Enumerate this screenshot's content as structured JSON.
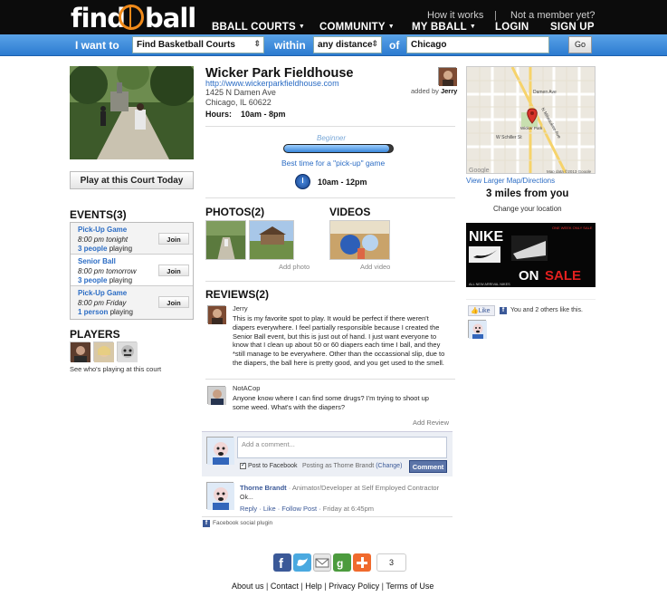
{
  "header": {
    "logo": "findbball",
    "nav": [
      "BBALL COURTS",
      "COMMUNITY",
      "MY BBALL"
    ],
    "how_it_works": "How it works",
    "not_member": "Not a member yet?",
    "login": "LOGIN",
    "signup": "SIGN UP"
  },
  "search": {
    "label_want": "I want to",
    "what": "Find Basketball Courts",
    "label_within": "within",
    "distance": "any distance",
    "label_of": "of",
    "location": "Chicago",
    "go": "Go"
  },
  "court": {
    "name": "Wicker Park Fieldhouse",
    "url": "http://www.wickerparkfieldhouse.com",
    "address1": "1425 N Damen Ave",
    "address2": "Chicago, IL 60622",
    "hours_label": "Hours:",
    "hours": "10am - 8pm",
    "added_by_label": "added by",
    "added_by": "Jerry",
    "play_button": "Play at this Court Today",
    "level": "Beginner",
    "level_fraction": 0.97,
    "best_time_label": "Best time for a \"pick-up\" game",
    "best_time": "10am - 12pm"
  },
  "events": {
    "title": "EVENTS(3)",
    "join_label": "Join",
    "items": [
      {
        "title": "Pick-Up Game",
        "when": "8:00 pm tonight",
        "count": "3 people",
        "suffix": "playing"
      },
      {
        "title": "Senior Ball",
        "when": "8:00 pm tomorrow",
        "count": "3 people",
        "suffix": "playing"
      },
      {
        "title": "Pick-Up Game",
        "when": "8:00 pm Friday",
        "count": "1 person",
        "suffix": "playing"
      }
    ]
  },
  "players": {
    "title": "PLAYERS",
    "see_link": "See who's playing at this court"
  },
  "media": {
    "photos_title": "PHOTOS(2)",
    "videos_title": "VIDEOS",
    "add_photo": "Add photo",
    "add_video": "Add video"
  },
  "reviews": {
    "title": "REVIEWS(2)",
    "add_review": "Add Review",
    "items": [
      {
        "name": "Jerry",
        "text": "This is my favorite spot to play. It would be perfect if there weren't diapers everywhere. I feel partially responsible because I created the Senior Ball event, but this is just out of hand.  I just want everyone to know that I clean up about 50 or 60 diapers each time I ball, and they *still manage to be everywhere.   Other than the occassional slip, due to the diapers, the ball here is pretty good, and you get used to the smell."
      },
      {
        "name": "NotACop",
        "text": "Anyone know where I can find some drugs?  I'm trying to shoot up some weed.  What's with the diapers?"
      }
    ]
  },
  "facebook": {
    "placeholder": "Add a comment...",
    "post_to": "Post to Facebook",
    "posting_as": "Posting as Thorne Brandt",
    "change": "(Change)",
    "comment_button": "Comment",
    "commenter": "Thorne Brandt",
    "commenter_role": "· Animator/Developer at Self Employed Contractor",
    "comment_text": "Ok...",
    "reply": "Reply",
    "like": "Like",
    "follow": "Follow Post",
    "time": "Friday at 6:45pm",
    "plugin_label": "Facebook social plugin",
    "like_button": "Like",
    "like_text": "You and 2 others like this."
  },
  "map": {
    "larger_map": "View Larger Map/Directions",
    "distance": "3 miles from you",
    "change_location": "Change your location",
    "streets": [
      "Damen Ave",
      "N Milwaukee Ave",
      "W Schiller St",
      "Wicker Park"
    ],
    "google": "Google",
    "map_data": "Map data ©2013 Google"
  },
  "ad": {
    "brand": "NIKE",
    "tagline": "ONE WEEK ONLY SALE",
    "on": "ON",
    "sale": "SALE",
    "footer": "ALL NEW ARRIVAL NIKES"
  },
  "share": {
    "count": "3"
  },
  "footer": {
    "links": [
      "About us",
      "Contact",
      "Help",
      "Privacy Policy",
      "Terms of Use"
    ]
  },
  "colors": {
    "brand_orange": "#f08a1a",
    "link_blue": "#2b6cc4",
    "search_blue": "#2c7bd0",
    "facebook_blue": "#3b5998"
  }
}
